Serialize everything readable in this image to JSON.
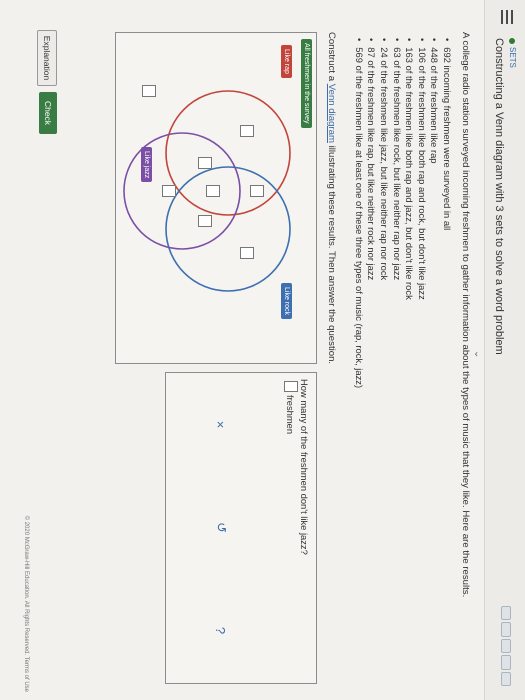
{
  "header": {
    "section_tag": "SETS",
    "title": "Constructing a Venn diagram with 3 sets to solve a word problem"
  },
  "problem": {
    "intro": "A college radio station surveyed incoming freshmen to gather information about the types of music that they like. Here are the results.",
    "facts": [
      "692 incoming freshmen were surveyed in all",
      "448 of the freshmen like rap",
      "106 of the freshmen like both rap and rock, but don't like jazz",
      "163 of the freshmen like both rap and jazz, but don't like rock",
      "63 of the freshmen like rock, but like neither rap nor jazz",
      "24 of the freshmen like jazz, but like neither rap nor rock",
      "87 of the freshmen like rap, but like neither rock nor jazz",
      "569 of the freshmen like at least one of these three types of music (rap, rock, jazz)"
    ],
    "construct_prefix": "Construct a ",
    "construct_link": "Venn diagram",
    "construct_suffix": " illustrating these results. Then answer the question."
  },
  "venn": {
    "universe_label": "All freshmen in the survey",
    "set_a_label": "Like rap",
    "set_b_label": "Like rock",
    "set_c_label": "Like jazz",
    "colors": {
      "universe": "#3a7d44",
      "rap": "#c2453b",
      "rock": "#3e6fb0",
      "jazz": "#7b4fa6"
    }
  },
  "question": {
    "text": "How many of the freshmen don't like jazz?",
    "unit": "freshmen"
  },
  "tools": {
    "clear_icon": "×",
    "undo_icon": "↺",
    "help_icon": "?"
  },
  "footer": {
    "explanation_label": "Explanation",
    "check_label": "Check",
    "copyright": "© 2020 McGraw-Hill Education. All Rights Reserved.   Terms of Use"
  }
}
